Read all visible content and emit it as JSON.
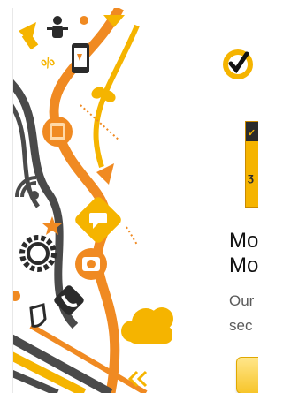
{
  "ad": {
    "headline_line1": "Mo",
    "headline_line2": "Mo",
    "subcopy_line1": "Our",
    "subcopy_line2": "sec"
  },
  "colors": {
    "brand_yellow": "#f5b400",
    "accent_orange": "#f08a22",
    "dark_gray": "#444444",
    "text_dark": "#111111",
    "text_muted": "#5a5a5a"
  },
  "icons": [
    "person-icon",
    "gear-icon",
    "smartphone-icon",
    "butterfly-icon",
    "sim-card-icon",
    "wifi-icon",
    "chat-bubble-icon",
    "camera-icon",
    "phone-icon",
    "shield-icon",
    "cloud-icon",
    "arrow-icon",
    "star-icon",
    "brand-checkmark-icon"
  ]
}
